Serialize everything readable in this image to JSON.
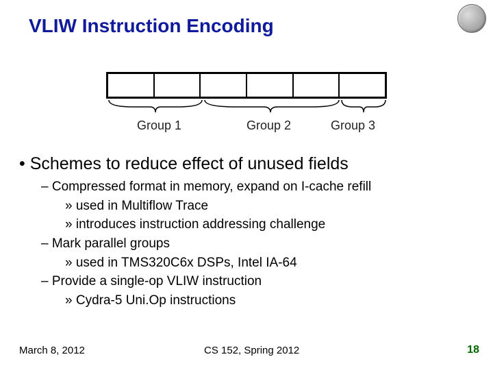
{
  "title": "VLIW Instruction Encoding",
  "groups": {
    "g1": "Group 1",
    "g2": "Group 2",
    "g3": "Group 3"
  },
  "main_bullet": "• Schemes to reduce effect of unused fields",
  "items": {
    "d1": "– Compressed format in memory, expand on I-cache refill",
    "d1a": "» used in Multiflow Trace",
    "d1b": "» introduces instruction addressing challenge",
    "d2": "– Mark parallel groups",
    "d2a": "» used in TMS320C6x DSPs, Intel IA-64",
    "d3": "– Provide a single-op VLIW instruction",
    "d3a": "» Cydra-5 Uni.Op instructions"
  },
  "footer": {
    "date": "March 8, 2012",
    "course": "CS 152, Spring 2012",
    "page": "18"
  }
}
